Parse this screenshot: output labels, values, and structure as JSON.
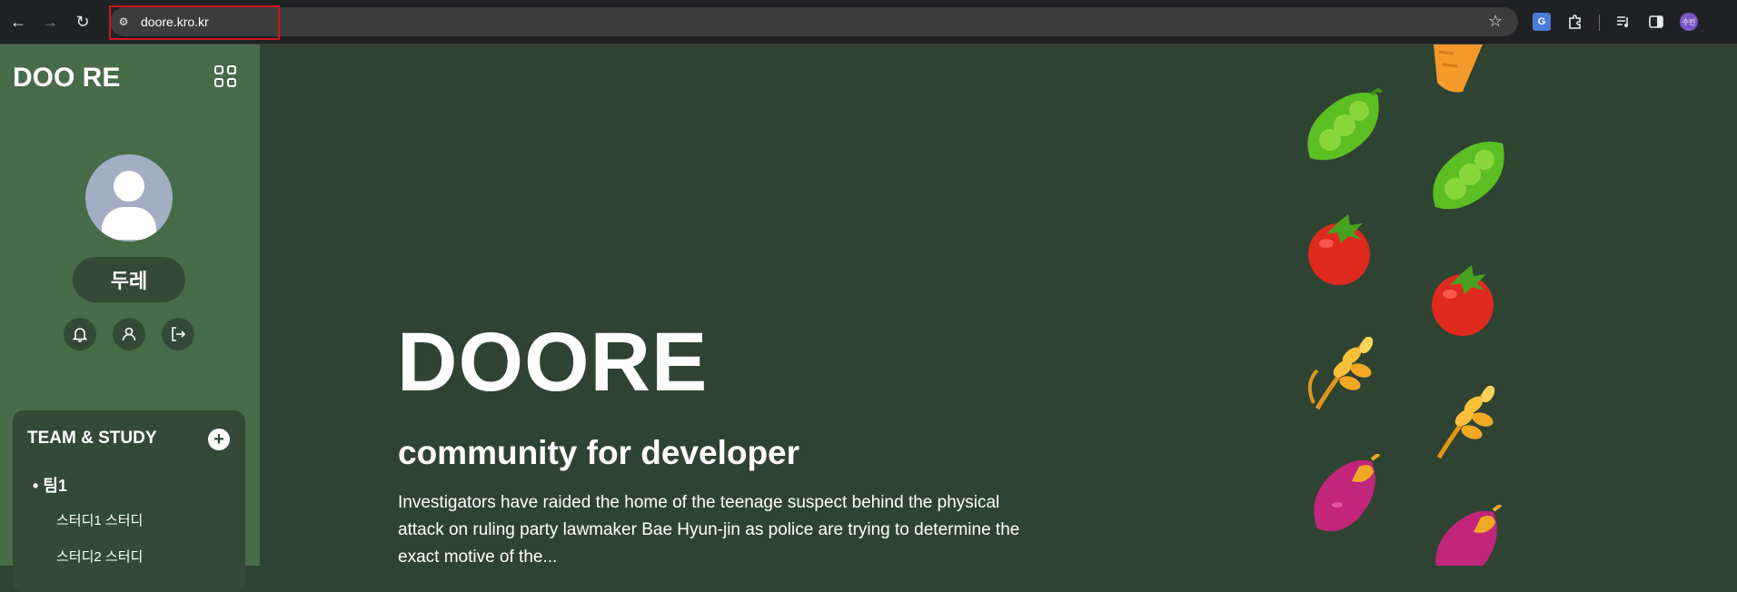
{
  "browser": {
    "url": "doore.kro.kr",
    "profile_initial": "수빈"
  },
  "sidebar": {
    "logo": "DOO RE",
    "user_name": "두레",
    "team_section_title": "TEAM & STUDY",
    "teams": [
      {
        "name": "팀1",
        "studies": [
          "스터디1 스터디",
          "스터디2 스터디"
        ]
      }
    ]
  },
  "hero": {
    "title": "DOORE",
    "subtitle": "community for developer",
    "description": "Investigators have raided the home of the teenage suspect behind the physical attack on ruling party lawmaker Bae Hyun-jin as police are trying to determine the exact motive of the..."
  },
  "colors": {
    "sidebar": "#486b4a",
    "main": "#2f4332",
    "pill": "#344a36"
  },
  "icons": {
    "nav": [
      "back-icon",
      "forward-icon",
      "reload-icon"
    ],
    "sidebar_actions": [
      "bell-icon",
      "user-icon",
      "logout-icon"
    ],
    "decorations": [
      "carrot-icon",
      "peas-icon",
      "tomato-icon",
      "wheat-icon",
      "sweet-potato-icon"
    ]
  }
}
